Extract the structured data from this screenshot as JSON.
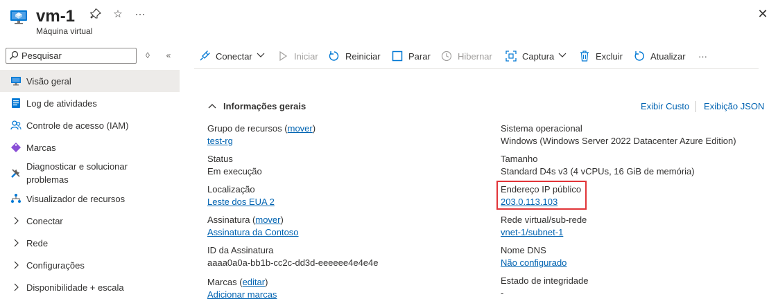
{
  "header": {
    "title": "vm-1",
    "subtitle": "Máquina virtual",
    "pin_icon": "pin-icon",
    "favorite_icon": "star-icon",
    "more_icon": "ellipsis-icon",
    "close_icon": "close-icon"
  },
  "sidebar": {
    "search_placeholder": "Pesquisar",
    "items": [
      {
        "label": "Visão geral",
        "icon": "monitor-icon"
      },
      {
        "label": "Log de atividades",
        "icon": "log-icon"
      },
      {
        "label": "Controle de acesso (IAM)",
        "icon": "people-icon"
      },
      {
        "label": "Marcas",
        "icon": "tag-icon"
      },
      {
        "label": "Diagnosticar e solucionar problemas",
        "icon": "wrench-icon"
      },
      {
        "label": "Visualizador de recursos",
        "icon": "hierarchy-icon"
      },
      {
        "label": "Conectar",
        "icon": "chevron-right-icon"
      },
      {
        "label": "Rede",
        "icon": "chevron-right-icon"
      },
      {
        "label": "Configurações",
        "icon": "chevron-right-icon"
      },
      {
        "label": "Disponibilidade + escala",
        "icon": "chevron-right-icon"
      }
    ]
  },
  "toolbar": {
    "connect": "Conectar",
    "start": "Iniciar",
    "restart": "Reiniciar",
    "stop": "Parar",
    "hibernate": "Hibernar",
    "capture": "Captura",
    "delete": "Excluir",
    "refresh": "Atualizar",
    "more": "···"
  },
  "overview": {
    "section_title": "Informações gerais",
    "view_cost": "Exibir Custo",
    "json_view": "Exibição JSON",
    "left": {
      "resource_group_label": "Grupo de recursos",
      "move_link": "mover",
      "resource_group_value": "test-rg",
      "status_label": "Status",
      "status_value": "Em execução",
      "location_label": "Localização",
      "location_value": "Leste dos EUA 2",
      "subscription_label": "Assinatura",
      "subscription_move_link": "mover",
      "subscription_value": "Assinatura da Contoso",
      "subscription_id_label": "ID da Assinatura",
      "subscription_id_value": "aaaa0a0a-bb1b-cc2c-dd3d-eeeeee4e4e4e",
      "tags_label": "Marcas",
      "tags_edit_link": "editar",
      "tags_value": "Adicionar marcas"
    },
    "right": {
      "os_label": "Sistema operacional",
      "os_value": "Windows (Windows Server 2022 Datacenter Azure Edition)",
      "size_label": "Tamanho",
      "size_value": "Standard D4s v3 (4 vCPUs, 16 GiB de memória)",
      "public_ip_label": "Endereço IP público",
      "public_ip_value": "203.0.113.103",
      "vnet_label": "Rede virtual/sub-rede",
      "vnet_value": "vnet-1/subnet-1",
      "dns_label": "Nome DNS",
      "dns_value": "Não configurado",
      "health_label": "Estado de integridade",
      "health_value": "-"
    }
  },
  "colors": {
    "accent": "#0078d4",
    "link": "#0063b1",
    "highlight": "#e13438",
    "active_nav": "#edebe9"
  }
}
